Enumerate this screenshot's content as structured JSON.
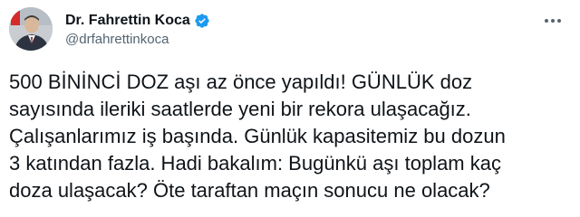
{
  "author": {
    "display_name": "Dr. Fahrettin Koca",
    "handle": "@drfahrettinkoca",
    "verified": true,
    "verified_color": "#1d9bf0",
    "avatar_icon": "profile-photo"
  },
  "menu": {
    "icon": "more-horizontal-icon"
  },
  "tweet": {
    "lines": [
      "500 BİNİNCİ DOZ aşı az önce yapıldı! GÜNLÜK doz",
      "sayısında ileriki saatlerde yeni bir rekora ulaşacağız.",
      "Çalışanlarımız iş başında. Günlük kapasitemiz bu dozun",
      "3 katından fazla. Hadi bakalım: Bugünkü aşı toplam kaç",
      "doza ulaşacak? Öte taraftan maçın sonucu ne olacak?"
    ]
  },
  "colors": {
    "text": "#0f1419",
    "secondary": "#536471",
    "background": "#ffffff"
  }
}
